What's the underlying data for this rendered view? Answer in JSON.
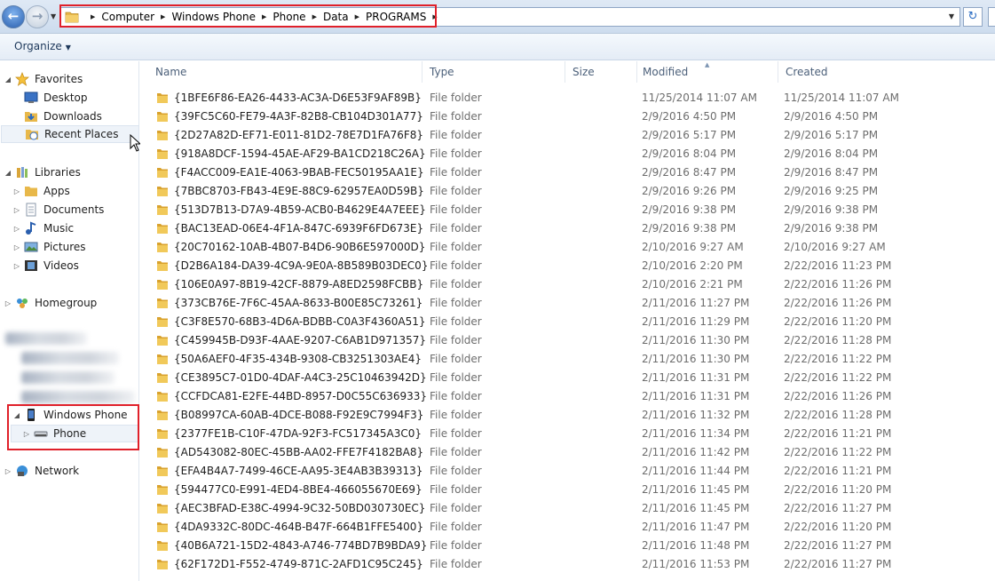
{
  "address_bar": {
    "crumbs": [
      "Computer",
      "Windows Phone",
      "Phone",
      "Data",
      "PROGRAMS"
    ]
  },
  "toolbar": {
    "organize_label": "Organize"
  },
  "nav": {
    "favorites": "Favorites",
    "desktop": "Desktop",
    "downloads": "Downloads",
    "recent_places": "Recent Places",
    "libraries": "Libraries",
    "apps": "Apps",
    "documents": "Documents",
    "music": "Music",
    "pictures": "Pictures",
    "videos": "Videos",
    "homegroup": "Homegroup",
    "windows_phone": "Windows Phone",
    "phone": "Phone",
    "network": "Network"
  },
  "columns": {
    "name": "Name",
    "type": "Type",
    "size": "Size",
    "modified": "Modified",
    "created": "Created"
  },
  "files": [
    {
      "name": "{1BFE6F86-EA26-4433-AC3A-D6E53F9AF89B}",
      "type": "File folder",
      "modified": "11/25/2014 11:07 AM",
      "created": "11/25/2014 11:07 AM"
    },
    {
      "name": "{39FC5C60-FE79-4A3F-82B8-CB104D301A77}",
      "type": "File folder",
      "modified": "2/9/2016 4:50 PM",
      "created": "2/9/2016 4:50 PM"
    },
    {
      "name": "{2D27A82D-EF71-E011-81D2-78E7D1FA76F8}",
      "type": "File folder",
      "modified": "2/9/2016 5:17 PM",
      "created": "2/9/2016 5:17 PM"
    },
    {
      "name": "{918A8DCF-1594-45AE-AF29-BA1CD218C26A}",
      "type": "File folder",
      "modified": "2/9/2016 8:04 PM",
      "created": "2/9/2016 8:04 PM"
    },
    {
      "name": "{F4ACC009-EA1E-4063-9BAB-FEC50195AA1E}",
      "type": "File folder",
      "modified": "2/9/2016 8:47 PM",
      "created": "2/9/2016 8:47 PM"
    },
    {
      "name": "{7BBC8703-FB43-4E9E-88C9-62957EA0D59B}",
      "type": "File folder",
      "modified": "2/9/2016 9:26 PM",
      "created": "2/9/2016 9:25 PM"
    },
    {
      "name": "{513D7B13-D7A9-4B59-ACB0-B4629E4A7EEE}",
      "type": "File folder",
      "modified": "2/9/2016 9:38 PM",
      "created": "2/9/2016 9:38 PM"
    },
    {
      "name": "{BAC13EAD-06E4-4F1A-847C-6939F6FD673E}",
      "type": "File folder",
      "modified": "2/9/2016 9:38 PM",
      "created": "2/9/2016 9:38 PM"
    },
    {
      "name": "{20C70162-10AB-4B07-B4D6-90B6E597000D}",
      "type": "File folder",
      "modified": "2/10/2016 9:27 AM",
      "created": "2/10/2016 9:27 AM"
    },
    {
      "name": "{D2B6A184-DA39-4C9A-9E0A-8B589B03DEC0}",
      "type": "File folder",
      "modified": "2/10/2016 2:20 PM",
      "created": "2/22/2016 11:23 PM"
    },
    {
      "name": "{106E0A97-8B19-42CF-8879-A8ED2598FCBB}",
      "type": "File folder",
      "modified": "2/10/2016 2:21 PM",
      "created": "2/22/2016 11:26 PM"
    },
    {
      "name": "{373CB76E-7F6C-45AA-8633-B00E85C73261}",
      "type": "File folder",
      "modified": "2/11/2016 11:27 PM",
      "created": "2/22/2016 11:26 PM"
    },
    {
      "name": "{C3F8E570-68B3-4D6A-BDBB-C0A3F4360A51}",
      "type": "File folder",
      "modified": "2/11/2016 11:29 PM",
      "created": "2/22/2016 11:20 PM"
    },
    {
      "name": "{C459945B-D93F-4AAE-9207-C6AB1D971357}",
      "type": "File folder",
      "modified": "2/11/2016 11:30 PM",
      "created": "2/22/2016 11:28 PM"
    },
    {
      "name": "{50A6AEF0-4F35-434B-9308-CB3251303AE4}",
      "type": "File folder",
      "modified": "2/11/2016 11:30 PM",
      "created": "2/22/2016 11:22 PM"
    },
    {
      "name": "{CE3895C7-01D0-4DAF-A4C3-25C10463942D}",
      "type": "File folder",
      "modified": "2/11/2016 11:31 PM",
      "created": "2/22/2016 11:22 PM"
    },
    {
      "name": "{CCFDCA81-E2FE-44BD-8957-D0C55C636933}",
      "type": "File folder",
      "modified": "2/11/2016 11:31 PM",
      "created": "2/22/2016 11:26 PM"
    },
    {
      "name": "{B08997CA-60AB-4DCE-B088-F92E9C7994F3}",
      "type": "File folder",
      "modified": "2/11/2016 11:32 PM",
      "created": "2/22/2016 11:28 PM"
    },
    {
      "name": "{2377FE1B-C10F-47DA-92F3-FC517345A3C0}",
      "type": "File folder",
      "modified": "2/11/2016 11:34 PM",
      "created": "2/22/2016 11:21 PM"
    },
    {
      "name": "{AD543082-80EC-45BB-AA02-FFE7F4182BA8}",
      "type": "File folder",
      "modified": "2/11/2016 11:42 PM",
      "created": "2/22/2016 11:22 PM"
    },
    {
      "name": "{EFA4B4A7-7499-46CE-AA95-3E4AB3B39313}",
      "type": "File folder",
      "modified": "2/11/2016 11:44 PM",
      "created": "2/22/2016 11:21 PM"
    },
    {
      "name": "{594477C0-E991-4ED4-8BE4-466055670E69}",
      "type": "File folder",
      "modified": "2/11/2016 11:45 PM",
      "created": "2/22/2016 11:20 PM"
    },
    {
      "name": "{AEC3BFAD-E38C-4994-9C32-50BD030730EC}",
      "type": "File folder",
      "modified": "2/11/2016 11:45 PM",
      "created": "2/22/2016 11:27 PM"
    },
    {
      "name": "{4DA9332C-80DC-464B-B47F-664B1FFE5400}",
      "type": "File folder",
      "modified": "2/11/2016 11:47 PM",
      "created": "2/22/2016 11:20 PM"
    },
    {
      "name": "{40B6A721-15D2-4843-A746-774BD7B9BDA9}",
      "type": "File folder",
      "modified": "2/11/2016 11:48 PM",
      "created": "2/22/2016 11:27 PM"
    },
    {
      "name": "{62F172D1-F552-4749-871C-2AFD1C95C245}",
      "type": "File folder",
      "modified": "2/11/2016 11:53 PM",
      "created": "2/22/2016 11:27 PM"
    }
  ],
  "colors": {
    "highlight_border": "#e0202a",
    "folder": "#e8b84a",
    "header_text": "#4c607a"
  },
  "icons": {
    "back": "back-arrow-icon",
    "forward": "forward-arrow-icon",
    "refresh": "refresh-icon",
    "folder": "folder-icon",
    "star": "favorites-star-icon",
    "phone": "windows-phone-icon"
  }
}
